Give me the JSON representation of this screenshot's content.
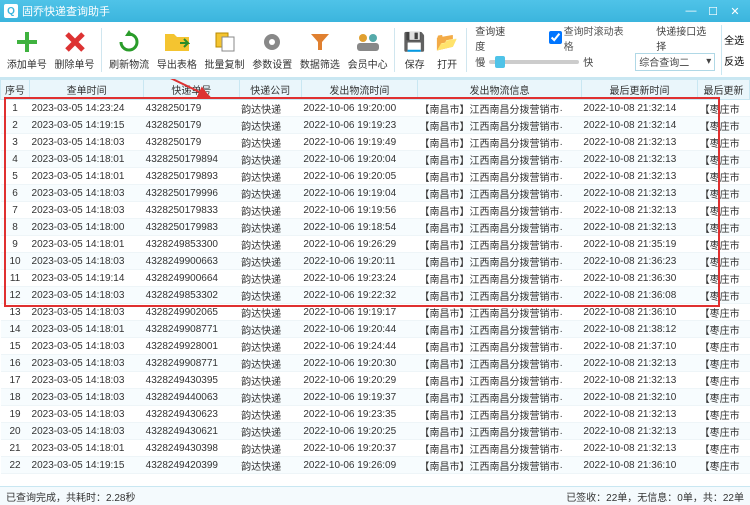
{
  "window": {
    "title": "固乔快递查询助手"
  },
  "toolbar": {
    "add": "添加单号",
    "del": "删除单号",
    "refresh": "刷新物流",
    "export": "导出表格",
    "copy": "批量复制",
    "settings": "参数设置",
    "filter": "数据筛选",
    "member": "会员中心",
    "save": "保存",
    "open": "打开",
    "speed_label": "查询速度",
    "slow": "慢",
    "fast": "快",
    "scroll_chk": "查询时滚动表格",
    "port_label": "快递接口选择",
    "port_combo": "综合查询二",
    "select_all": "全选",
    "invert": "反选"
  },
  "columns": [
    "序号",
    "查单时间",
    "快递单号",
    "快递公司",
    "发出物流时间",
    "发出物流信息",
    "最后更新时间",
    "最后更新"
  ],
  "rows": [
    {
      "n": 1,
      "t": "2023-03-05 14:23:24",
      "no": "4328250179",
      "co": "韵达快递",
      "st": "2022-10-06 19:20:00",
      "info": "【南昌市】江西南昌分拨营销市·",
      "ut": "2022-10-08 21:32:14",
      "last": "【枣庄市"
    },
    {
      "n": 2,
      "t": "2023-03-05 14:19:15",
      "no": "4328250179",
      "co": "韵达快递",
      "st": "2022-10-06 19:19:23",
      "info": "【南昌市】江西南昌分拨营销市·",
      "ut": "2022-10-08 21:32:14",
      "last": "【枣庄市"
    },
    {
      "n": 3,
      "t": "2023-03-05 14:18:03",
      "no": "4328250179",
      "co": "韵达快递",
      "st": "2022-10-06 19:19:49",
      "info": "【南昌市】江西南昌分拨营销市·",
      "ut": "2022-10-08 21:32:13",
      "last": "【枣庄市"
    },
    {
      "n": 4,
      "t": "2023-03-05 14:18:01",
      "no": "4328250179894",
      "co": "韵达快递",
      "st": "2022-10-06 19:20:04",
      "info": "【南昌市】江西南昌分拨营销市·",
      "ut": "2022-10-08 21:32:13",
      "last": "【枣庄市"
    },
    {
      "n": 5,
      "t": "2023-03-05 14:18:01",
      "no": "4328250179893",
      "co": "韵达快递",
      "st": "2022-10-06 19:20:05",
      "info": "【南昌市】江西南昌分拨营销市·",
      "ut": "2022-10-08 21:32:13",
      "last": "【枣庄市"
    },
    {
      "n": 6,
      "t": "2023-03-05 14:18:03",
      "no": "4328250179996",
      "co": "韵达快递",
      "st": "2022-10-06 19:19:04",
      "info": "【南昌市】江西南昌分拨营销市·",
      "ut": "2022-10-08 21:32:13",
      "last": "【枣庄市"
    },
    {
      "n": 7,
      "t": "2023-03-05 14:18:03",
      "no": "4328250179833",
      "co": "韵达快递",
      "st": "2022-10-06 19:19:56",
      "info": "【南昌市】江西南昌分拨营销市·",
      "ut": "2022-10-08 21:32:13",
      "last": "【枣庄市"
    },
    {
      "n": 8,
      "t": "2023-03-05 14:18:00",
      "no": "4328250179983",
      "co": "韵达快递",
      "st": "2022-10-06 19:18:54",
      "info": "【南昌市】江西南昌分拨营销市·",
      "ut": "2022-10-08 21:32:13",
      "last": "【枣庄市"
    },
    {
      "n": 9,
      "t": "2023-03-05 14:18:01",
      "no": "4328249853300",
      "co": "韵达快递",
      "st": "2022-10-06 19:26:29",
      "info": "【南昌市】江西南昌分拨营销市·",
      "ut": "2022-10-08 21:35:19",
      "last": "【枣庄市"
    },
    {
      "n": 10,
      "t": "2023-03-05 14:18:03",
      "no": "4328249900663",
      "co": "韵达快递",
      "st": "2022-10-06 19:20:11",
      "info": "【南昌市】江西南昌分拨营销市·",
      "ut": "2022-10-08 21:36:23",
      "last": "【枣庄市"
    },
    {
      "n": 11,
      "t": "2023-03-05 14:19:14",
      "no": "4328249900664",
      "co": "韵达快递",
      "st": "2022-10-06 19:23:24",
      "info": "【南昌市】江西南昌分拨营销市·",
      "ut": "2022-10-08 21:36:30",
      "last": "【枣庄市"
    },
    {
      "n": 12,
      "t": "2023-03-05 14:18:03",
      "no": "4328249853302",
      "co": "韵达快递",
      "st": "2022-10-06 19:22:32",
      "info": "【南昌市】江西南昌分拨营销市·",
      "ut": "2022-10-08 21:36:08",
      "last": "【枣庄市"
    },
    {
      "n": 13,
      "t": "2023-03-05 14:18:03",
      "no": "4328249902065",
      "co": "韵达快递",
      "st": "2022-10-06 19:19:17",
      "info": "【南昌市】江西南昌分拨营销市·",
      "ut": "2022-10-08 21:36:10",
      "last": "【枣庄市"
    },
    {
      "n": 14,
      "t": "2023-03-05 14:18:01",
      "no": "4328249908771",
      "co": "韵达快递",
      "st": "2022-10-06 19:20:44",
      "info": "【南昌市】江西南昌分拨营销市·",
      "ut": "2022-10-08 21:38:12",
      "last": "【枣庄市"
    },
    {
      "n": 15,
      "t": "2023-03-05 14:18:03",
      "no": "4328249928001",
      "co": "韵达快递",
      "st": "2022-10-06 19:24:44",
      "info": "【南昌市】江西南昌分拨营销市·",
      "ut": "2022-10-08 21:37:10",
      "last": "【枣庄市"
    },
    {
      "n": 16,
      "t": "2023-03-05 14:18:03",
      "no": "4328249908771",
      "co": "韵达快递",
      "st": "2022-10-06 19:20:30",
      "info": "【南昌市】江西南昌分拨营销市·",
      "ut": "2022-10-08 21:32:13",
      "last": "【枣庄市"
    },
    {
      "n": 17,
      "t": "2023-03-05 14:18:03",
      "no": "4328249430395",
      "co": "韵达快递",
      "st": "2022-10-06 19:20:29",
      "info": "【南昌市】江西南昌分拨营销市·",
      "ut": "2022-10-08 21:32:13",
      "last": "【枣庄市"
    },
    {
      "n": 18,
      "t": "2023-03-05 14:18:03",
      "no": "4328249440063",
      "co": "韵达快递",
      "st": "2022-10-06 19:19:37",
      "info": "【南昌市】江西南昌分拨营销市·",
      "ut": "2022-10-08 21:32:10",
      "last": "【枣庄市"
    },
    {
      "n": 19,
      "t": "2023-03-05 14:18:03",
      "no": "4328249430623",
      "co": "韵达快递",
      "st": "2022-10-06 19:23:35",
      "info": "【南昌市】江西南昌分拨营销市·",
      "ut": "2022-10-08 21:32:13",
      "last": "【枣庄市"
    },
    {
      "n": 20,
      "t": "2023-03-05 14:18:03",
      "no": "4328249430621",
      "co": "韵达快递",
      "st": "2022-10-06 19:20:25",
      "info": "【南昌市】江西南昌分拨营销市·",
      "ut": "2022-10-08 21:32:13",
      "last": "【枣庄市"
    },
    {
      "n": 21,
      "t": "2023-03-05 14:18:01",
      "no": "4328249430398",
      "co": "韵达快递",
      "st": "2022-10-06 19:20:37",
      "info": "【南昌市】江西南昌分拨营销市·",
      "ut": "2022-10-08 21:32:13",
      "last": "【枣庄市"
    },
    {
      "n": 22,
      "t": "2023-03-05 14:19:15",
      "no": "4328249420399",
      "co": "韵达快递",
      "st": "2022-10-06 19:26:09",
      "info": "【南昌市】江西南昌分拨营销市·",
      "ut": "2022-10-08 21:36:10",
      "last": "【枣庄市"
    }
  ],
  "status": {
    "left": "已查询完成，共耗时：2.28秒",
    "right": "已签收：22单，无信息：0单，共：22单"
  }
}
